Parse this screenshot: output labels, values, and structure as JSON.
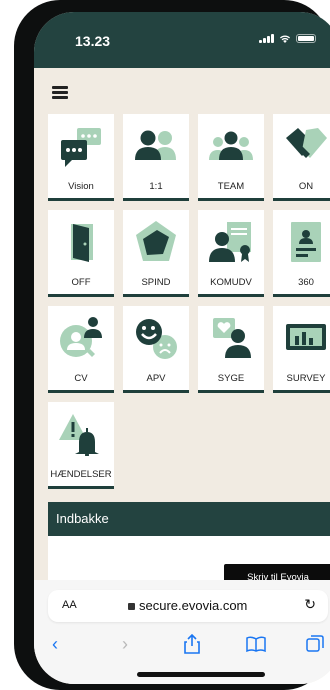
{
  "status": {
    "time": "13.23"
  },
  "tiles": [
    {
      "label": "Vision",
      "icon": "chat-bubbles-icon"
    },
    {
      "label": "1:1",
      "icon": "two-people-icon"
    },
    {
      "label": "TEAM",
      "icon": "team-icon"
    },
    {
      "label": "ON",
      "icon": "handshake-icon"
    },
    {
      "label": "OFF",
      "icon": "door-exit-icon"
    },
    {
      "label": "SPIND",
      "icon": "spider-chart-icon"
    },
    {
      "label": "KOMUDV",
      "icon": "person-certificate-icon"
    },
    {
      "label": "360",
      "icon": "id-badge-icon"
    },
    {
      "label": "CV",
      "icon": "person-search-icon"
    },
    {
      "label": "APV",
      "icon": "smiley-icon"
    },
    {
      "label": "SYGE",
      "icon": "person-heart-icon"
    },
    {
      "label": "SURVEY",
      "icon": "bar-chart-icon"
    },
    {
      "label": "HÆNDELSER",
      "icon": "warning-bell-icon"
    }
  ],
  "inbox": {
    "title": "Indbakke",
    "write_label": "Skriv til Evovia"
  },
  "browser": {
    "text_size_label": "AA",
    "url": "secure.evovia.com"
  },
  "colors": {
    "brand": "#234340",
    "icon_light": "#a9d2b8",
    "icon_dark": "#1f3f3b",
    "page_bg": "#f1ebe2"
  }
}
